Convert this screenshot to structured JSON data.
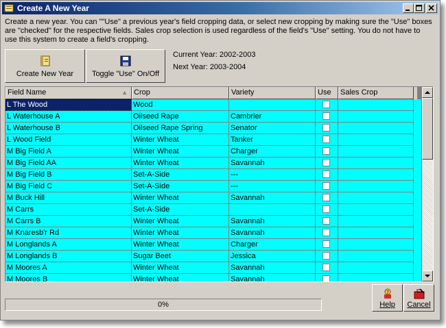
{
  "window": {
    "title": "Create A New Year"
  },
  "intro_text": "Create a new year.  You can \"\"Use\" a previous year's field cropping data, or select new cropping by making sure the \"Use\" boxes are \"checked\" for the respective fields.  Sales crop selection is used regardless of the field's \"Use\" setting.  You do not have to use this system to create a field's cropping.",
  "toolbar": {
    "create_label": "Create New Year",
    "toggle_label": "Toggle \"Use\" On/Off"
  },
  "years": {
    "current": "Current Year: 2002-2003",
    "next": "Next Year: 2003-2004"
  },
  "grid": {
    "columns": [
      "Field Name",
      "Crop",
      "Variety",
      "Use",
      "Sales Crop"
    ],
    "sort_indicator": "▲",
    "rows": [
      {
        "field": "L The Wood",
        "crop": "Wood",
        "variety": "",
        "use": false,
        "sales": ""
      },
      {
        "field": "L Waterhouse A",
        "crop": "Oilseed Rape",
        "variety": "Cambrier",
        "use": false,
        "sales": ""
      },
      {
        "field": "L Waterhouse B",
        "crop": "Oilseed Rape Spring",
        "variety": "Senator",
        "use": false,
        "sales": ""
      },
      {
        "field": "L Wood Field",
        "crop": "Winter Wheat",
        "variety": "Tanker",
        "use": false,
        "sales": ""
      },
      {
        "field": "M Big Field A",
        "crop": "Winter Wheat",
        "variety": "Charger",
        "use": false,
        "sales": ""
      },
      {
        "field": "M Big Field AA",
        "crop": "Winter Wheat",
        "variety": "Savannah",
        "use": false,
        "sales": ""
      },
      {
        "field": "M Big Field B",
        "crop": "Set-A-Side",
        "variety": "---",
        "use": false,
        "sales": ""
      },
      {
        "field": "M Big Field C",
        "crop": "Set-A-Side",
        "variety": "---",
        "use": false,
        "sales": ""
      },
      {
        "field": "M Buck Hill",
        "crop": "Winter Wheat",
        "variety": "Savannah",
        "use": false,
        "sales": ""
      },
      {
        "field": "M Carrs",
        "crop": "Set-A-Side",
        "variety": "",
        "use": false,
        "sales": ""
      },
      {
        "field": "M Carrs B",
        "crop": "Winter Wheat",
        "variety": "Savannah",
        "use": false,
        "sales": ""
      },
      {
        "field": "M Knaresb'r Rd",
        "crop": "Winter Wheat",
        "variety": "Savannah",
        "use": false,
        "sales": ""
      },
      {
        "field": "M Longlands A",
        "crop": "Winter Wheat",
        "variety": "Charger",
        "use": false,
        "sales": ""
      },
      {
        "field": "M Longlands B",
        "crop": "Sugar Beet",
        "variety": "Jessica",
        "use": false,
        "sales": ""
      },
      {
        "field": "M Moores A",
        "crop": "Winter Wheat",
        "variety": "Savannah",
        "use": false,
        "sales": ""
      },
      {
        "field": "M Moores B",
        "crop": "Winter Wheat",
        "variety": "Savannah",
        "use": false,
        "sales": ""
      }
    ]
  },
  "progress": {
    "label": "0%",
    "value": 0
  },
  "buttons": {
    "help_label": "Help",
    "cancel_label": "Cancel"
  },
  "colors": {
    "row_background": "#00ffff",
    "selection": "#0a246a",
    "title_gradient_start": "#0a246a"
  }
}
